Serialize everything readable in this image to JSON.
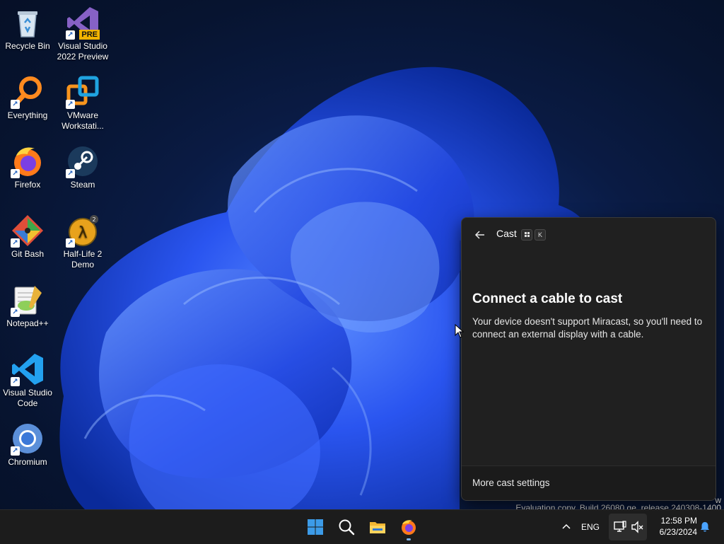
{
  "desktop": {
    "icons": [
      {
        "label": "Recycle Bin",
        "icon": "recycle-bin-icon"
      },
      {
        "label": "Visual Studio 2022 Preview",
        "icon": "visual-studio-preview-icon",
        "badge": "PRE"
      },
      {
        "label": "Everything",
        "icon": "everything-search-icon"
      },
      {
        "label": "VMware Workstati...",
        "icon": "vmware-workstation-icon"
      },
      {
        "label": "Firefox",
        "icon": "firefox-icon"
      },
      {
        "label": "Steam",
        "icon": "steam-icon"
      },
      {
        "label": "Git Bash",
        "icon": "git-bash-icon"
      },
      {
        "label": "Half-Life 2 Demo",
        "icon": "half-life-2-icon"
      },
      {
        "label": "Notepad++",
        "icon": "notepad-plus-plus-icon"
      },
      {
        "label": "Visual Studio Code",
        "icon": "vscode-icon"
      },
      {
        "label": "Chromium",
        "icon": "chromium-icon"
      }
    ],
    "watermark_line1": "w",
    "watermark_line2": "Evaluation copy. Build 26080.ge_release.240308-1400"
  },
  "cast_panel": {
    "back_icon": "back-arrow-icon",
    "title": "Cast",
    "shortcut_key": "K",
    "heading": "Connect a cable to cast",
    "message": "Your device doesn't support Miracast, so you'll need to connect an external display with a cable.",
    "more_settings": "More cast settings"
  },
  "taskbar": {
    "apps": [
      {
        "name": "Start",
        "icon": "windows-start-icon"
      },
      {
        "name": "Search",
        "icon": "search-icon"
      },
      {
        "name": "File Explorer",
        "icon": "folder-icon"
      },
      {
        "name": "Firefox",
        "icon": "firefox-icon",
        "active": true
      }
    ],
    "tray": {
      "chevron": "^",
      "language": "ENG",
      "time": "12:58 PM",
      "date": "6/23/2024"
    }
  },
  "colors": {
    "accent": "#1f6fe5",
    "panel_bg": "#202020",
    "taskbar_bg": "#1c1c1c",
    "wallpaper_dark": "#071430",
    "wallpaper_bloom": "#2f5cff"
  }
}
